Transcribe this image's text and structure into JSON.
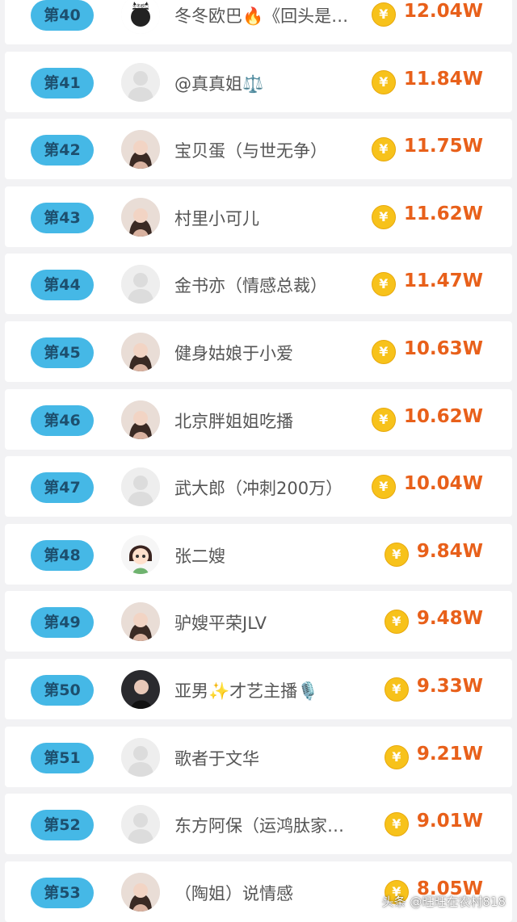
{
  "rows": [
    {
      "rank": "第40",
      "name": "冬冬欧巴🔥《回头是…",
      "amount": "12.04W",
      "avatar": "cat-logo"
    },
    {
      "rank": "第41",
      "name": "@真真姐⚖️",
      "amount": "11.84W",
      "avatar": "default"
    },
    {
      "rank": "第42",
      "name": "宝贝蛋（与世无争）",
      "amount": "11.75W",
      "avatar": "photo"
    },
    {
      "rank": "第43",
      "name": "村里小可儿",
      "amount": "11.62W",
      "avatar": "photo"
    },
    {
      "rank": "第44",
      "name": "金书亦（情感总裁）",
      "amount": "11.47W",
      "avatar": "default"
    },
    {
      "rank": "第45",
      "name": "健身姑娘于小爱",
      "amount": "10.63W",
      "avatar": "photo"
    },
    {
      "rank": "第46",
      "name": "北京胖姐姐吃播",
      "amount": "10.62W",
      "avatar": "photo"
    },
    {
      "rank": "第47",
      "name": "武大郎（冲刺200万）",
      "amount": "10.04W",
      "avatar": "default"
    },
    {
      "rank": "第48",
      "name": "张二嫂",
      "amount": "9.84W",
      "avatar": "cartoon"
    },
    {
      "rank": "第49",
      "name": "驴嫂平荣JLV",
      "amount": "9.48W",
      "avatar": "photo"
    },
    {
      "rank": "第50",
      "name": "亚男✨才艺主播🎙️",
      "amount": "9.33W",
      "avatar": "photo-dark"
    },
    {
      "rank": "第51",
      "name": "歌者于文华",
      "amount": "9.21W",
      "avatar": "default"
    },
    {
      "rank": "第52",
      "name": "东方阿保（运鸿肽家…",
      "amount": "9.01W",
      "avatar": "default"
    },
    {
      "rank": "第53",
      "name": "（陶姐）说情感",
      "amount": "8.05W",
      "avatar": "photo"
    }
  ],
  "coin_symbol": "¥",
  "watermark": "头条 @旺旺在农村818",
  "colors": {
    "rank_badge": "#45b8e6",
    "rank_text": "#1d4f6e",
    "amount": "#e8601a",
    "coin": "#f7c21b"
  }
}
